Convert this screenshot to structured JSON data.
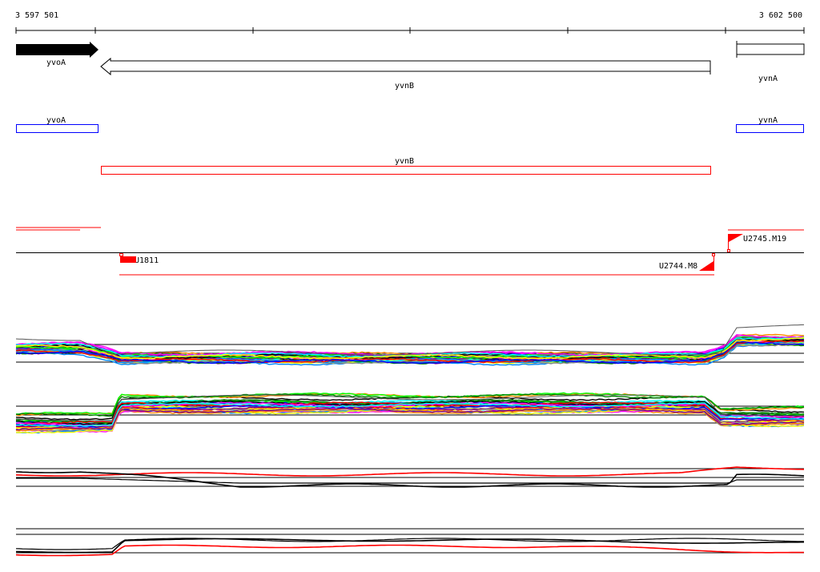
{
  "ruler": {
    "start_label": "3 597 501",
    "end_label": "3 602 500",
    "start": 3597501,
    "end": 3602500
  },
  "genes": [
    {
      "name": "yvoA",
      "start": 3597501,
      "end": 3598030,
      "strand": "+",
      "filled": true
    },
    {
      "name": "yvnB",
      "start": 3598050,
      "end": 3601920,
      "strand": "-",
      "filled": false
    },
    {
      "name": "yvnA",
      "start": 3602080,
      "end": 3602500,
      "strand": "+",
      "filled": false
    }
  ],
  "annotations": [
    {
      "name": "yvoA",
      "color": "#0000ff"
    },
    {
      "name": "yvnB",
      "color": "#ff0000"
    },
    {
      "name": "yvnA",
      "color": "#0000ff"
    }
  ],
  "transcripts": [
    {
      "label": "U1811"
    },
    {
      "label": "U2744.M8"
    },
    {
      "label": "U2745.M19"
    }
  ],
  "colors": {
    "accent": "#ff0000",
    "axis": "#000000",
    "blue": "#0000ff"
  }
}
